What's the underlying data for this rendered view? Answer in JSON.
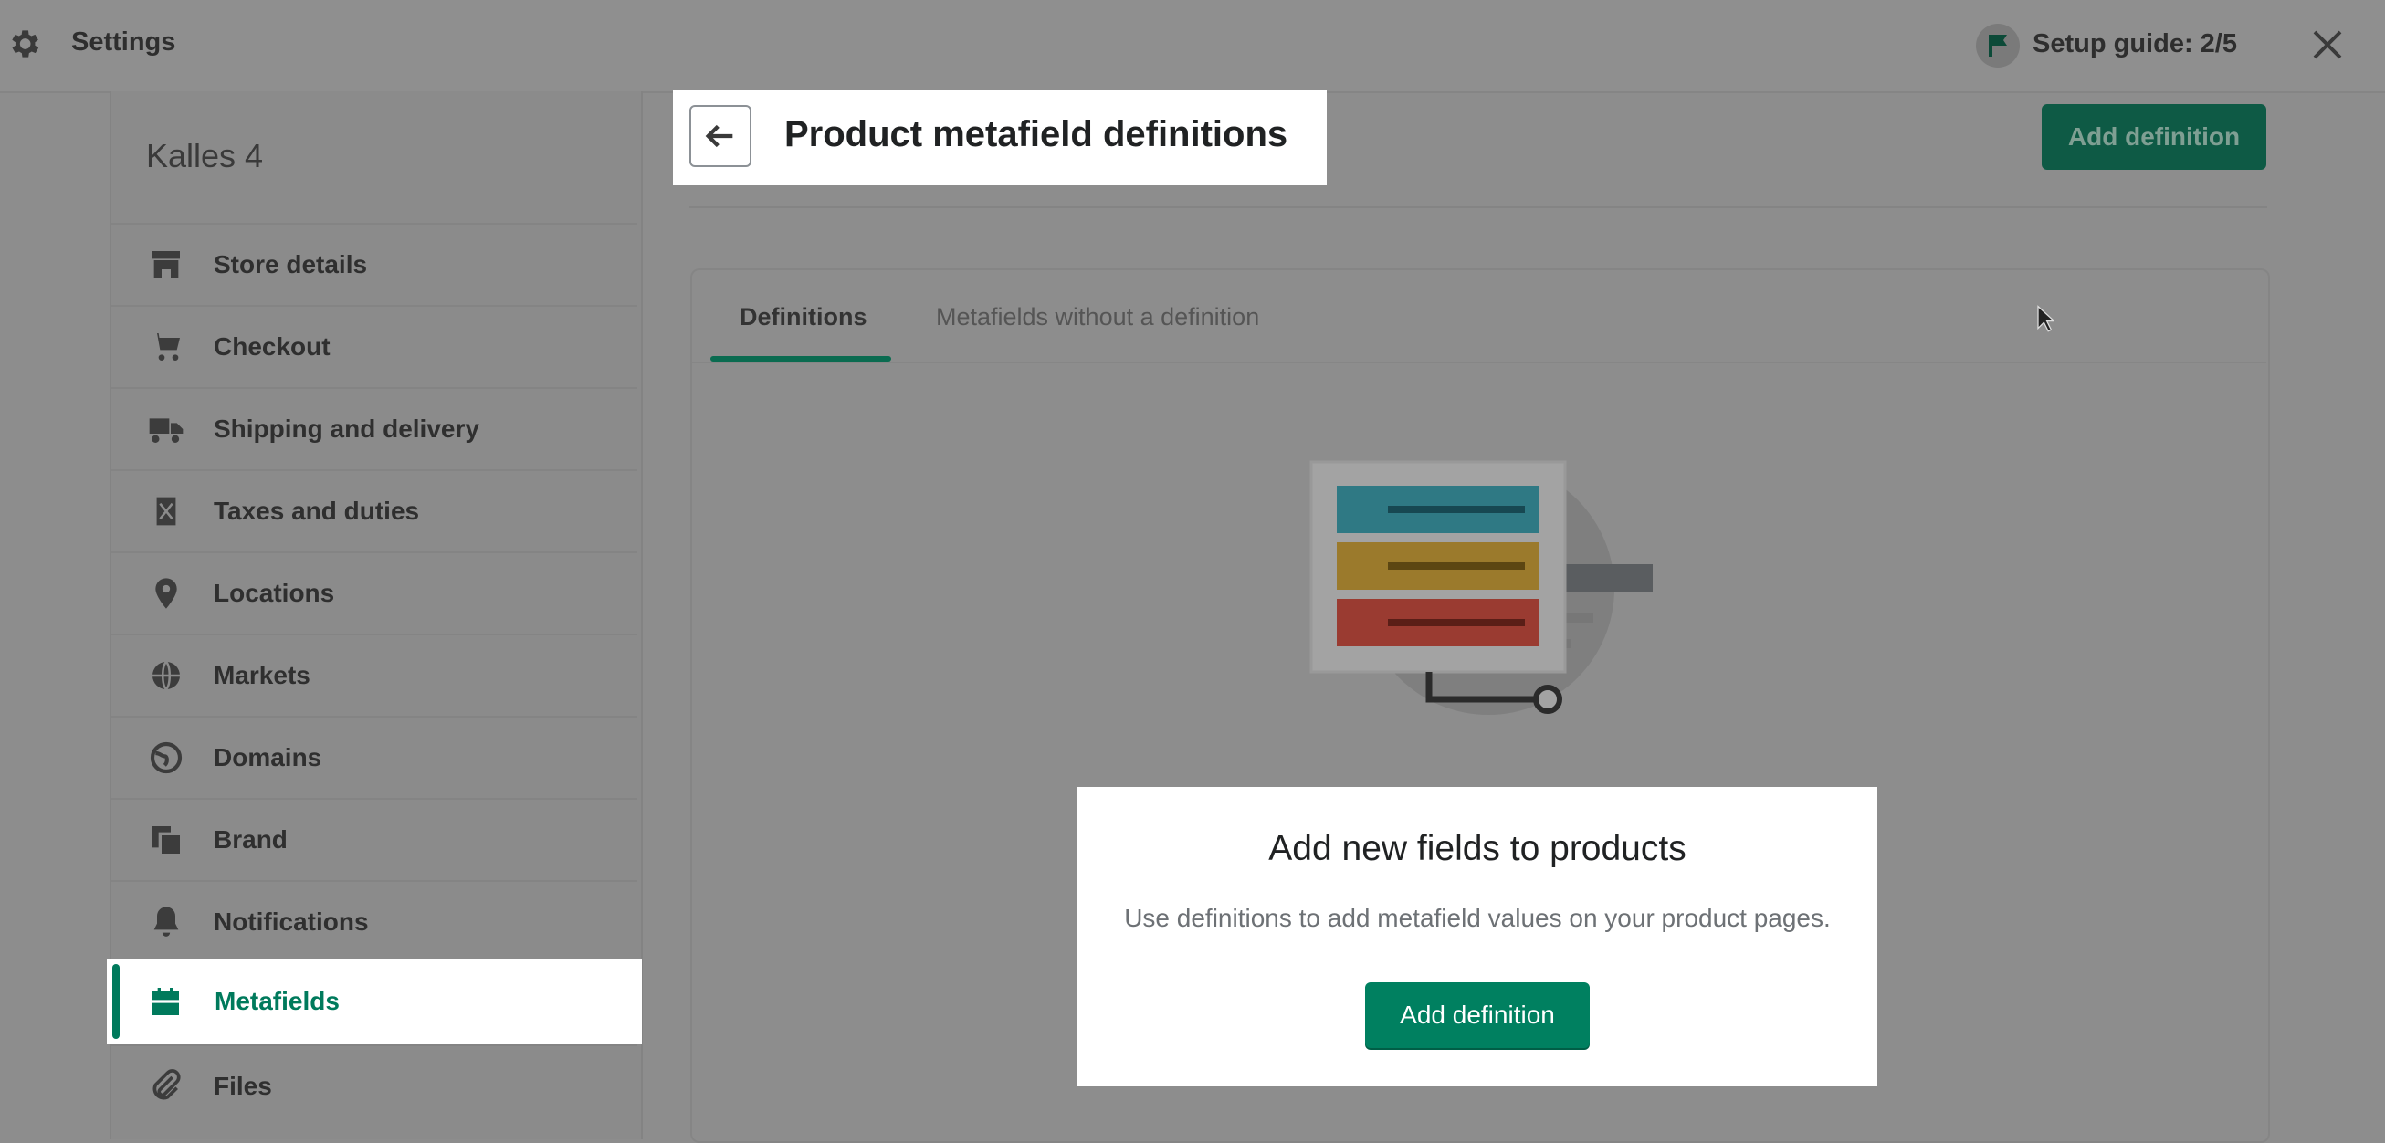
{
  "topbar": {
    "title": "Settings",
    "setup_guide": "Setup guide: 2/5"
  },
  "sidebar": {
    "store_name": "Kalles 4",
    "items": [
      {
        "label": "Store details",
        "icon": "store-icon"
      },
      {
        "label": "Checkout",
        "icon": "cart-icon"
      },
      {
        "label": "Shipping and delivery",
        "icon": "truck-icon"
      },
      {
        "label": "Taxes and duties",
        "icon": "receipt-icon"
      },
      {
        "label": "Locations",
        "icon": "location-pin-icon"
      },
      {
        "label": "Markets",
        "icon": "globe-icon"
      },
      {
        "label": "Domains",
        "icon": "globe-icon"
      },
      {
        "label": "Brand",
        "icon": "brand-icon"
      },
      {
        "label": "Notifications",
        "icon": "bell-icon"
      },
      {
        "label": "Metafields",
        "icon": "metafields-icon",
        "active": true
      },
      {
        "label": "Files",
        "icon": "paperclip-icon"
      }
    ]
  },
  "header": {
    "title": "Product metafield definitions",
    "add_definition": "Add definition"
  },
  "tabs": [
    {
      "label": "Definitions",
      "selected": true
    },
    {
      "label": "Metafields without a definition",
      "selected": false
    }
  ],
  "empty_state": {
    "heading": "Add new fields to products",
    "description": "Use definitions to add metafield values on your product pages.",
    "button": "Add definition"
  },
  "colors": {
    "accent": "#008060",
    "overlay": "#8d8d8d"
  }
}
